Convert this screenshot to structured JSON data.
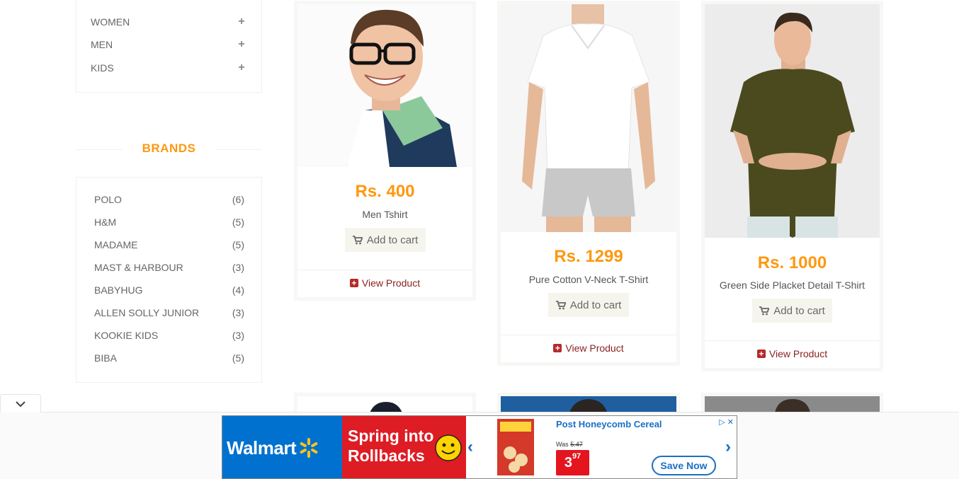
{
  "categories": [
    {
      "label": "WOMEN",
      "icon": "plus"
    },
    {
      "label": "MEN",
      "icon": "plus"
    },
    {
      "label": "KIDS",
      "icon": "plus"
    }
  ],
  "brands": {
    "title": "BRANDS",
    "items": [
      {
        "name": "POLO",
        "count": "(6)"
      },
      {
        "name": "H&M",
        "count": "(5)"
      },
      {
        "name": "MADAME",
        "count": "(5)"
      },
      {
        "name": "MAST & HARBOUR",
        "count": "(3)"
      },
      {
        "name": "BABYHUG",
        "count": "(4)"
      },
      {
        "name": "ALLEN SOLLY JUNIOR",
        "count": "(3)"
      },
      {
        "name": "KOOKIE KIDS",
        "count": "(3)"
      },
      {
        "name": "BIBA",
        "count": "(5)"
      }
    ]
  },
  "products": [
    {
      "price": "Rs. 400",
      "name": "Men Tshirt",
      "cart_label": "Add to cart",
      "view_label": "View Product"
    },
    {
      "price": "Rs. 1299",
      "name": "Pure Cotton V-Neck T-Shirt",
      "cart_label": "Add to cart",
      "view_label": "View Product"
    },
    {
      "price": "Rs. 1000",
      "name": "Green Side Placket Detail T-Shirt",
      "cart_label": "Add to cart",
      "view_label": "View Product"
    }
  ],
  "ad": {
    "brand": "Walmart",
    "headline_line1": "Spring into",
    "headline_line2": "Rollbacks",
    "product_title": "Post Honeycomb Cereal",
    "was_label": "Was",
    "was_price": "5.47",
    "price_main": "3",
    "price_cents": "97",
    "cta": "Save Now"
  },
  "colors": {
    "accent": "#fe980f",
    "view_link": "#8a1f1f",
    "walmart_blue": "#0071ce",
    "rollback_red": "#de1c24"
  }
}
